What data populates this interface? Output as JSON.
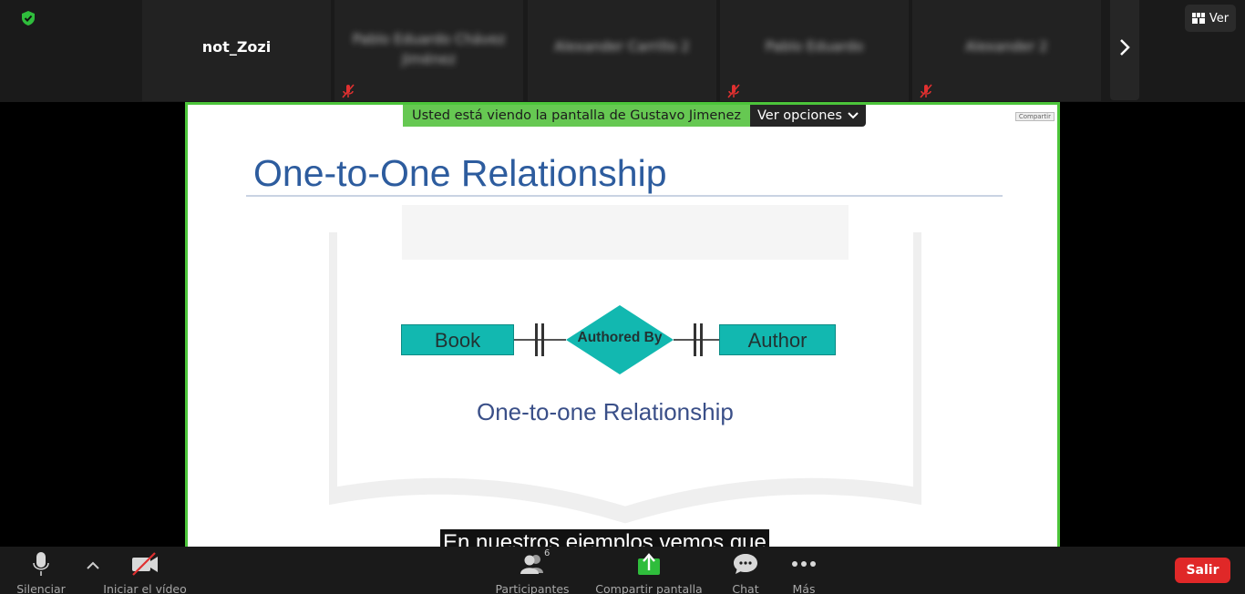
{
  "participants": [
    {
      "name": "not_Zozi",
      "muted": false,
      "blurred": false
    },
    {
      "name": "Pablo Eduardo Chávez Jiménez",
      "muted": true,
      "blurred": true
    },
    {
      "name": "Alexander Carrillo 2",
      "muted": false,
      "blurred": true
    },
    {
      "name": "Pablo Eduardo",
      "muted": true,
      "blurred": true
    },
    {
      "name": "Alexander 2",
      "muted": true,
      "blurred": true
    }
  ],
  "view_button": {
    "label": "Ver",
    "icon": "gallery-grid-icon"
  },
  "share_banner": {
    "message": "Usted está viendo la pantalla de Gustavo Jimenez",
    "options_label": "Ver opciones",
    "mini_share_label": "Compartir"
  },
  "slide": {
    "title": "One-to-One Relationship",
    "entity_left": "Book",
    "relationship": "Authored By",
    "entity_right": "Author",
    "subtitle": "One-to-one Relationship",
    "caption": "En nuestros ejemplos vemos que"
  },
  "toolbar": {
    "mute_label": "Silenciar",
    "video_label": "Iniciar el vídeo",
    "participants_label": "Participantes",
    "participants_count": "6",
    "share_label": "Compartir pantalla",
    "chat_label": "Chat",
    "more_label": "Más",
    "leave_label": "Salir"
  },
  "colors": {
    "share_border": "#4cc53a",
    "banner_green": "#66c852",
    "leave_red": "#e02828",
    "entity_teal": "#12b8b0",
    "title_blue": "#2d5c9e",
    "share_icon_green": "#2fbd3c"
  }
}
